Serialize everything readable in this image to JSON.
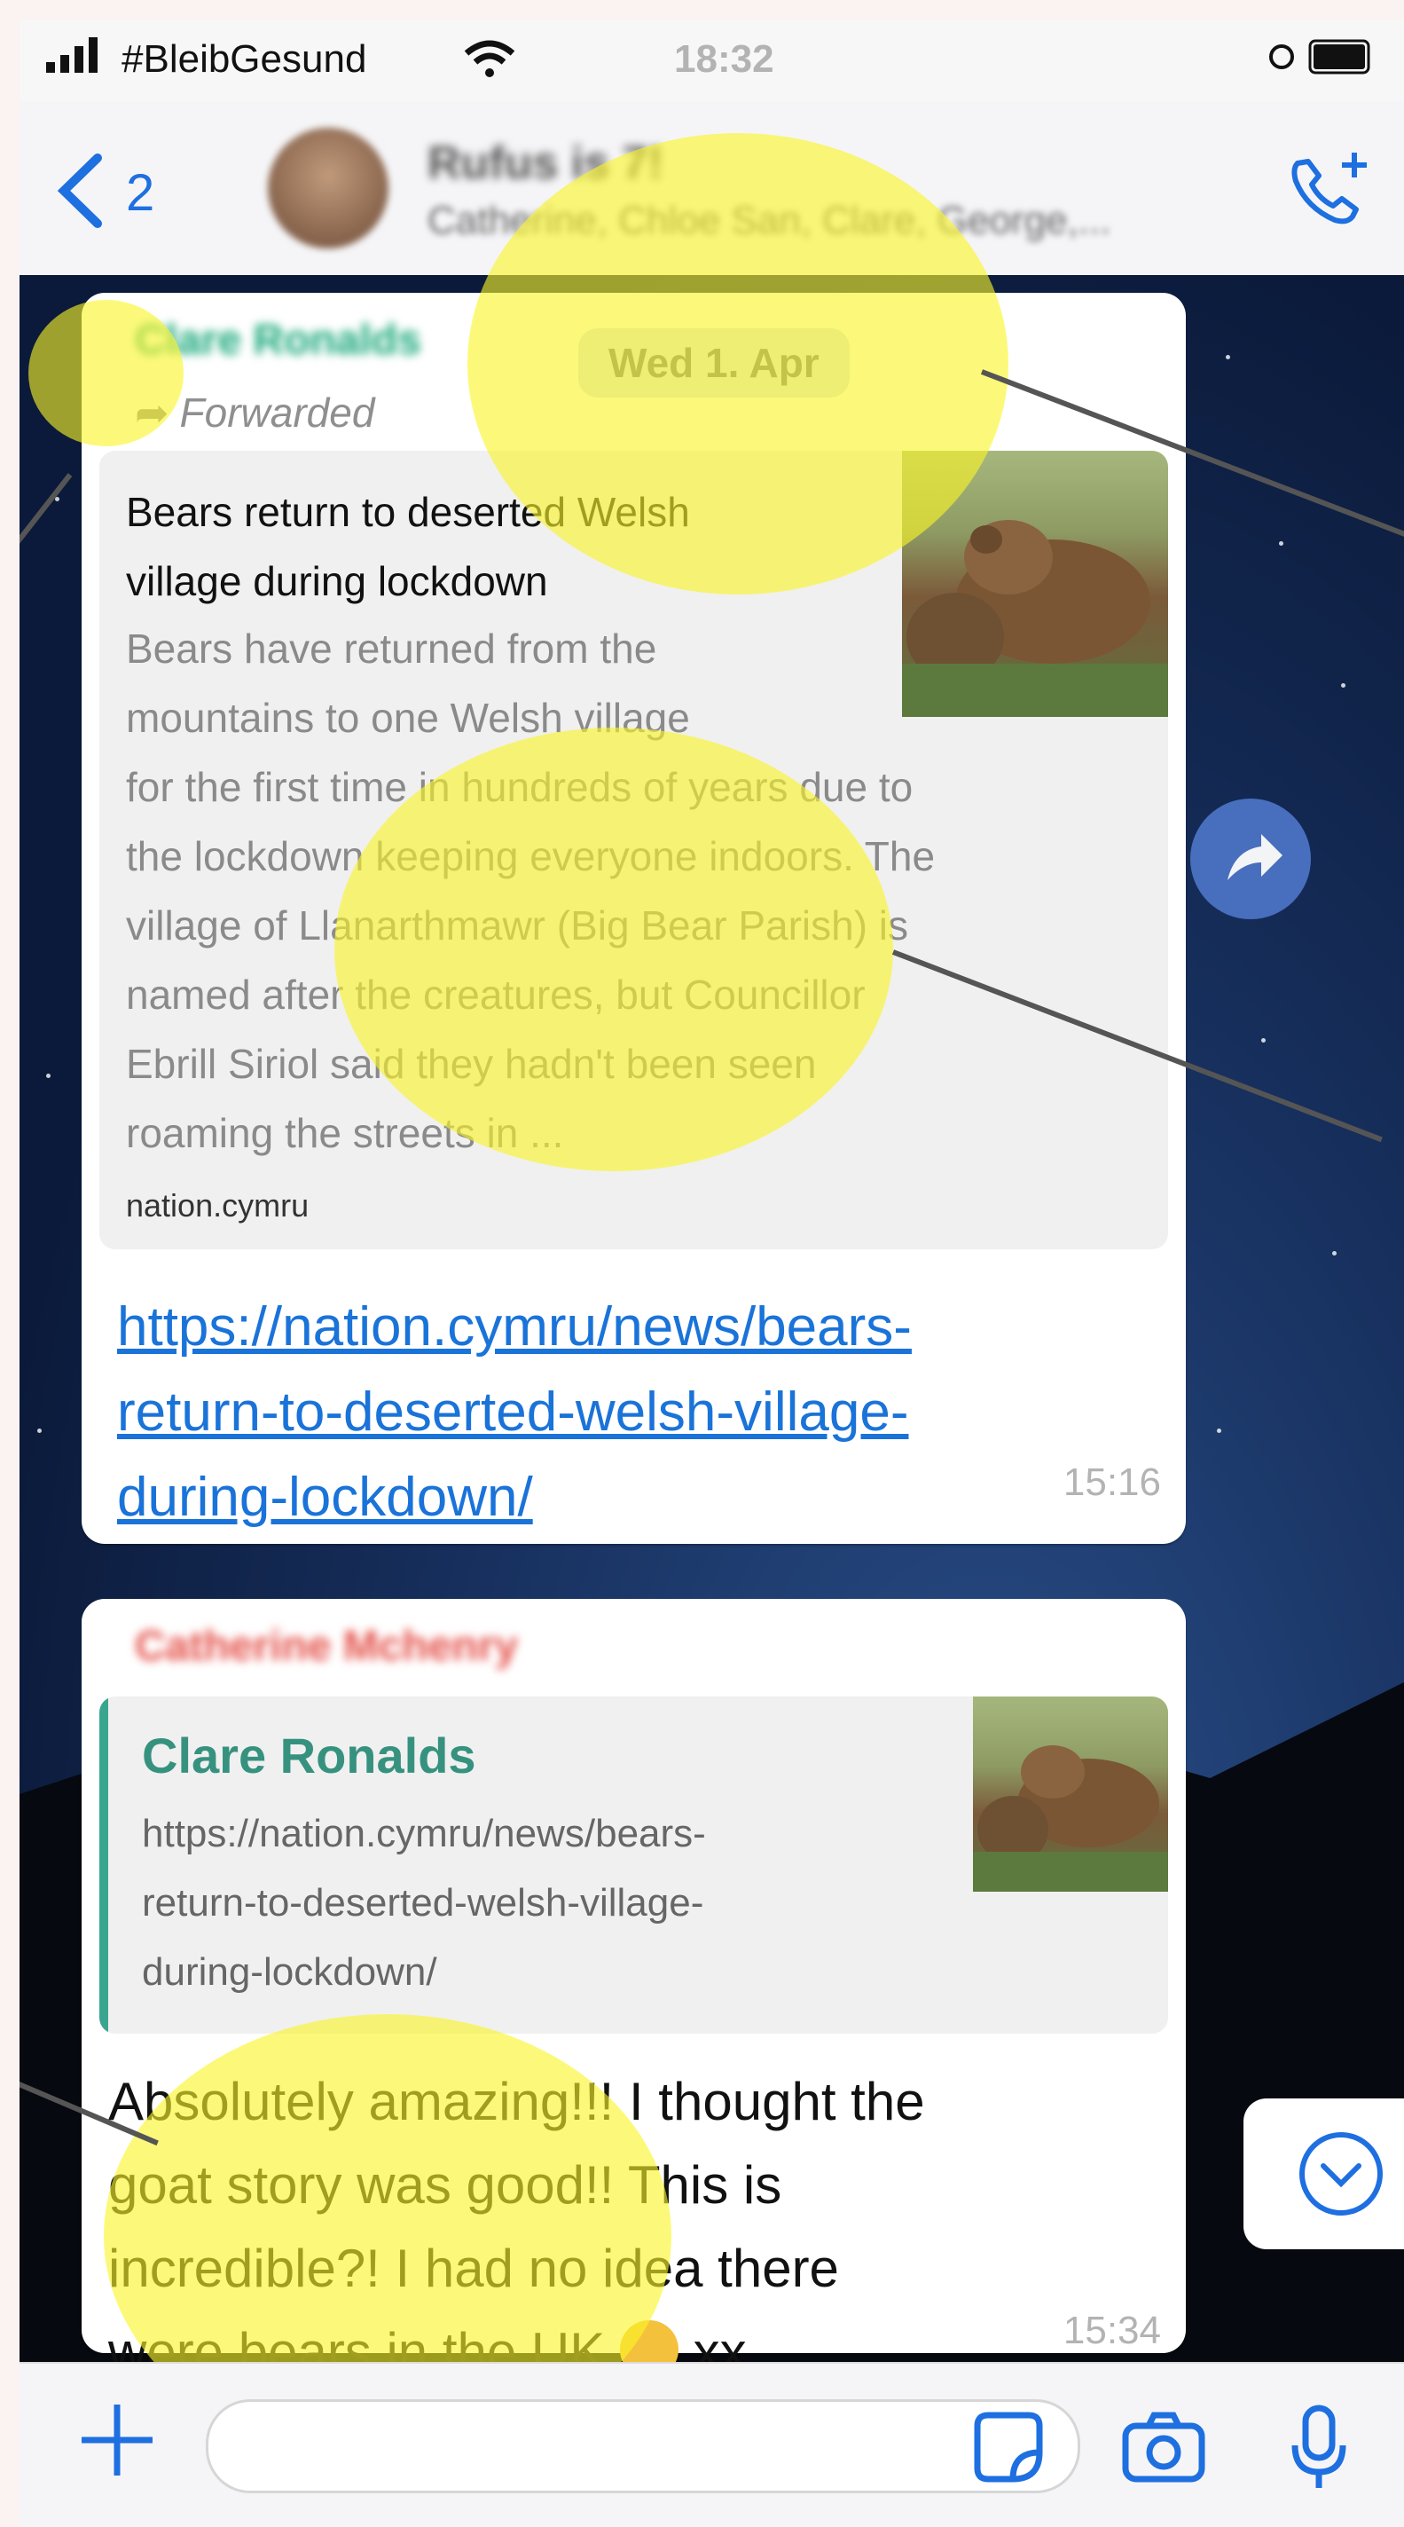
{
  "status_bar": {
    "carrier": "#BleibGesund",
    "time": "18:32"
  },
  "header": {
    "back_count": "2",
    "group_name": "Rufus is 7!",
    "members": "Catherine, Chloe San, Clare, George,..."
  },
  "chat": {
    "date_pill": "Wed 1. Apr",
    "message1": {
      "sender": "Clare Ronalds",
      "forwarded_label": "Forwarded",
      "preview_title_lines": [
        "Bears return to deserted Welsh",
        "village during lockdown"
      ],
      "preview_desc_lines": [
        "Bears have returned from the",
        "mountains to one Welsh village",
        "for the first time in hundreds of years due to",
        "the lockdown keeping everyone indoors. The",
        "village of Llanarthmawr (Big Bear Parish) is",
        "named after the creatures, but Councillor",
        "Ebrill Siriol said they hadn't been seen",
        "roaming the streets in ..."
      ],
      "preview_domain": "nation.cymru",
      "link_lines": [
        "https://nation.cymru/news/bears-",
        "return-to-deserted-welsh-village-",
        "during-lockdown/"
      ],
      "time": "15:16"
    },
    "message2": {
      "sender": "Catherine Mchenry",
      "quote_author": "Clare Ronalds",
      "quote_lines": [
        "https://nation.cymru/news/bears-",
        "return-to-deserted-welsh-village-",
        "during-lockdown/"
      ],
      "text_lines": [
        "Absolutely amazing!!! I thought the",
        "goat story was good!! This is",
        "incredible?! I had no idea there",
        "were bears in the UK"
      ],
      "text_tail": "xx",
      "time": "15:34"
    }
  },
  "icons": {
    "signal": "signal-icon",
    "wifi": "wifi-icon",
    "battery": "battery-icon",
    "back": "chevron-left-icon",
    "add_call": "add-call-icon",
    "share": "share-arrow-icon",
    "scroll_down": "chevron-down-circle-icon",
    "plus": "plus-icon",
    "sticker": "sticker-icon",
    "camera": "camera-icon",
    "mic": "microphone-icon"
  },
  "colors": {
    "accent": "#1e6fe0",
    "link": "#1a73d9",
    "highlight": "#f8f43a",
    "sender1": "#1aa87a",
    "sender2": "#e4524b",
    "quote_bar": "#3aa58f"
  }
}
